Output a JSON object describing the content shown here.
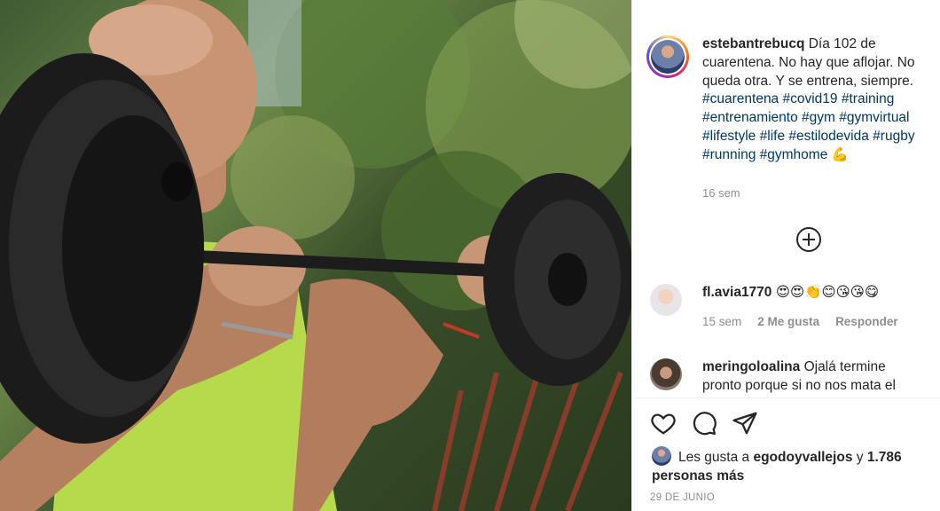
{
  "post": {
    "username": "estebantrebucq",
    "caption_text": "Día 102 de cuarentena. No hay que aflojar. No queda otra. Y se entrena, siempre.",
    "hashtags": [
      "#cuarentena",
      "#covid19",
      "#training",
      "#entrenamiento",
      "#gym",
      "#gymvirtual",
      "#lifestyle",
      "#life",
      "#estilodevida",
      "#rugby",
      "#running",
      "#gymhome"
    ],
    "caption_emoji": "💪",
    "caption_time": "16 sem",
    "load_more_icon": "plus-circle-icon"
  },
  "comments": [
    {
      "username": "fl.avia1770",
      "text": "😍😍👏😊😘😘😋",
      "time": "15 sem",
      "likes": "2 Me gusta",
      "reply": "Responder"
    },
    {
      "username": "meringoloalina",
      "text": "Ojalá termine pronto porque si no nos mata el"
    }
  ],
  "actions": {
    "icons": [
      "heart-icon",
      "comment-icon",
      "share-icon"
    ]
  },
  "likes_summary": {
    "prefix": "Les gusta a",
    "user": "egodoyvallejos",
    "connector": "y",
    "others": "1.786 personas más"
  },
  "date": "29 DE JUNIO",
  "colors": {
    "hashtag": "#00376b",
    "text": "#262626",
    "meta": "#8e8e8e"
  }
}
